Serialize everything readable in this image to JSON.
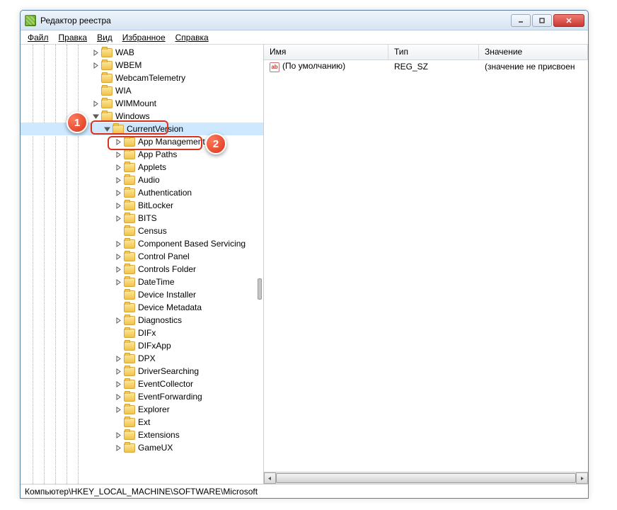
{
  "window": {
    "title": "Редактор реестра"
  },
  "menu": {
    "file": "Файл",
    "edit": "Правка",
    "view": "Вид",
    "favorites": "Избранное",
    "help": "Справка"
  },
  "tree": {
    "prefix_items": [
      {
        "indent": 100,
        "exp": "closed",
        "label": "WAB"
      },
      {
        "indent": 100,
        "exp": "closed",
        "label": "WBEM"
      },
      {
        "indent": 100,
        "exp": "none",
        "label": "WebcamTelemetry"
      },
      {
        "indent": 100,
        "exp": "none",
        "label": "WIA"
      },
      {
        "indent": 100,
        "exp": "closed",
        "label": "WIMMount"
      },
      {
        "indent": 100,
        "exp": "open",
        "label": "Windows",
        "key": "windows"
      },
      {
        "indent": 116,
        "exp": "open",
        "label": "CurrentVersion",
        "key": "currentversion",
        "selected": true
      }
    ],
    "current_children": [
      "App Management",
      "App Paths",
      "Applets",
      "Audio",
      "Authentication",
      "BitLocker",
      "BITS",
      "Census",
      "Component Based Servicing",
      "Control Panel",
      "Controls Folder",
      "DateTime",
      "Device Installer",
      "Device Metadata",
      "Diagnostics",
      "DIFx",
      "DIFxApp",
      "DPX",
      "DriverSearching",
      "EventCollector",
      "EventForwarding",
      "Explorer",
      "Ext",
      "Extensions",
      "GameUX"
    ],
    "child_expands": {
      "Device Installer": "none",
      "Device Metadata": "none",
      "Census": "none",
      "DIFx": "none",
      "DIFxApp": "none",
      "Ext": "none"
    }
  },
  "list": {
    "columns": {
      "name": "Имя",
      "type": "Тип",
      "value": "Значение"
    },
    "rows": [
      {
        "name": "(По умолчанию)",
        "type": "REG_SZ",
        "value": "(значение не присвоен"
      }
    ]
  },
  "statusbar": "Компьютер\\HKEY_LOCAL_MACHINE\\SOFTWARE\\Microsoft",
  "callouts": {
    "one": "1",
    "two": "2"
  }
}
